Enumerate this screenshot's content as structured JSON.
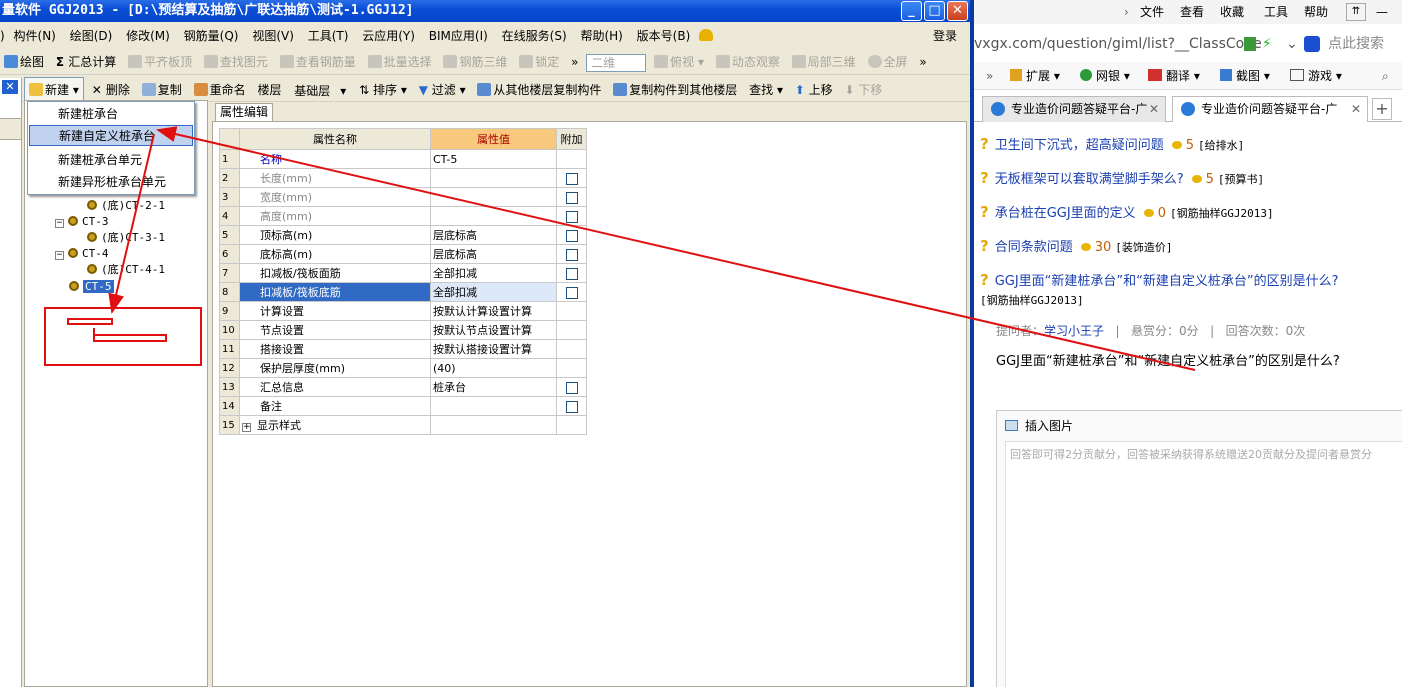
{
  "app": {
    "title": "量软件 GGJ2013 - [D:\\预结算及抽筋\\广联达抽筋\\测试-1.GGJ12]",
    "window_buttons": [
      "_",
      "□",
      "✕"
    ],
    "menu": [
      "构件(N)",
      "绘图(D)",
      "修改(M)",
      "钢筋量(Q)",
      "视图(V)",
      "工具(T)",
      "云应用(Y)",
      "BIM应用(I)",
      "在线服务(S)",
      "帮助(H)",
      "版本号(B)"
    ],
    "menu_prefix": ")",
    "login": "登录",
    "toolbar1": {
      "draw": "绘图",
      "sum": "汇总计算",
      "flat": "平齐板顶",
      "find": "查找图元",
      "view_rebar": "查看钢筋量",
      "batch": "批量选择",
      "rebar3d": "钢筋三维",
      "lock": "锁定",
      "dim": "二维",
      "top_view": "俯视",
      "dynamic": "动态观察",
      "local3d": "局部三维",
      "full": "全屏",
      "more": "»"
    },
    "toolbar2": {
      "new": "新建",
      "delete": "删除",
      "copy": "复制",
      "rename": "重命名",
      "floor_label": "楼层",
      "floor_value": "基础层",
      "sort": "排序",
      "filter": "过滤",
      "copy_from": "从其他楼层复制构件",
      "copy_to": "复制构件到其他楼层",
      "find": "查找",
      "up": "上移",
      "down": "下移"
    },
    "dropdown": [
      "新建桩承台",
      "新建自定义桩承台",
      "新建桩承台单元",
      "新建异形桩承台单元"
    ],
    "tree": [
      {
        "label": "(底)CT-2-1",
        "kind": "child"
      },
      {
        "label": "CT-3",
        "kind": "parent"
      },
      {
        "label": "(底)CT-3-1",
        "kind": "child"
      },
      {
        "label": "CT-4",
        "kind": "parent"
      },
      {
        "label": "(底)CT-4-1",
        "kind": "child"
      },
      {
        "label": "CT-5",
        "kind": "selected"
      }
    ],
    "prop_tab": "属性编辑",
    "prop_headers": [
      "属性名称",
      "属性值",
      "附加"
    ],
    "props": [
      {
        "n": "1",
        "name": "名称",
        "value": "CT-5",
        "cb": false
      },
      {
        "n": "2",
        "name": "长度(mm)",
        "value": "",
        "cb": true
      },
      {
        "n": "3",
        "name": "宽度(mm)",
        "value": "",
        "cb": true
      },
      {
        "n": "4",
        "name": "高度(mm)",
        "value": "",
        "cb": true
      },
      {
        "n": "5",
        "name": "顶标高(m)",
        "value": "层底标高",
        "cb": true
      },
      {
        "n": "6",
        "name": "底标高(m)",
        "value": "层底标高",
        "cb": true
      },
      {
        "n": "7",
        "name": "扣减板/筏板面筋",
        "value": "全部扣减",
        "cb": true
      },
      {
        "n": "8",
        "name": "扣减板/筏板底筋",
        "value": "全部扣减",
        "cb": true
      },
      {
        "n": "9",
        "name": "计算设置",
        "value": "按默认计算设置计算",
        "cb": false
      },
      {
        "n": "10",
        "name": "节点设置",
        "value": "按默认节点设置计算",
        "cb": false
      },
      {
        "n": "11",
        "name": "搭接设置",
        "value": "按默认搭接设置计算",
        "cb": false
      },
      {
        "n": "12",
        "name": "保护层厚度(mm)",
        "value": "(40)",
        "cb": false
      },
      {
        "n": "13",
        "name": "汇总信息",
        "value": "桩承台",
        "cb": true
      },
      {
        "n": "14",
        "name": "备注",
        "value": "",
        "cb": true
      },
      {
        "n": "15",
        "name": "显示样式",
        "value": "",
        "cb": false
      }
    ]
  },
  "browser": {
    "menu": [
      "文件",
      "查看",
      "收藏",
      "工具",
      "帮助"
    ],
    "address": "vxgx.com/question/giml/list?__ClassCode",
    "search_placeholder": "点此搜索",
    "favbar": [
      "扩展",
      "网银",
      "翻译",
      "截图",
      "游戏"
    ],
    "tabs": [
      "专业造价问题答疑平台-广",
      "专业造价问题答疑平台-广"
    ],
    "questions": [
      {
        "title": "卫生间下沉式，超高疑问问题",
        "score": "5",
        "cat": "[给排水]"
      },
      {
        "title": "无板框架可以套取满堂脚手架么?",
        "score": "5",
        "cat": "[预算书]"
      },
      {
        "title": "承台桩在GGJ里面的定义",
        "score": "0",
        "cat": "[钢筋抽样GGJ2013]"
      },
      {
        "title": "合同条款问题",
        "score": "30",
        "cat": "[装饰造价]"
      },
      {
        "title": "GGJ里面“新建桩承台”和“新建自定义桩承台”的区别是什么?",
        "score": "",
        "cat": ""
      }
    ],
    "q5_cat": "[钢筋抽样GGJ2013]",
    "meta_asker_label": "提问者：",
    "meta_asker": "学习小王子",
    "meta_reward": "悬赏分：0分",
    "meta_answers": "回答次数：0次",
    "meta_sep": "|",
    "question_body": "GGJ里面“新建桩承台”和“新建自定义桩承台”的区别是什么?",
    "insert_image": "插入图片",
    "answer_placeholder": "回答即可得2分贡献分，回答被采纳获得系统赠送20贡献分及提问者悬赏分"
  }
}
